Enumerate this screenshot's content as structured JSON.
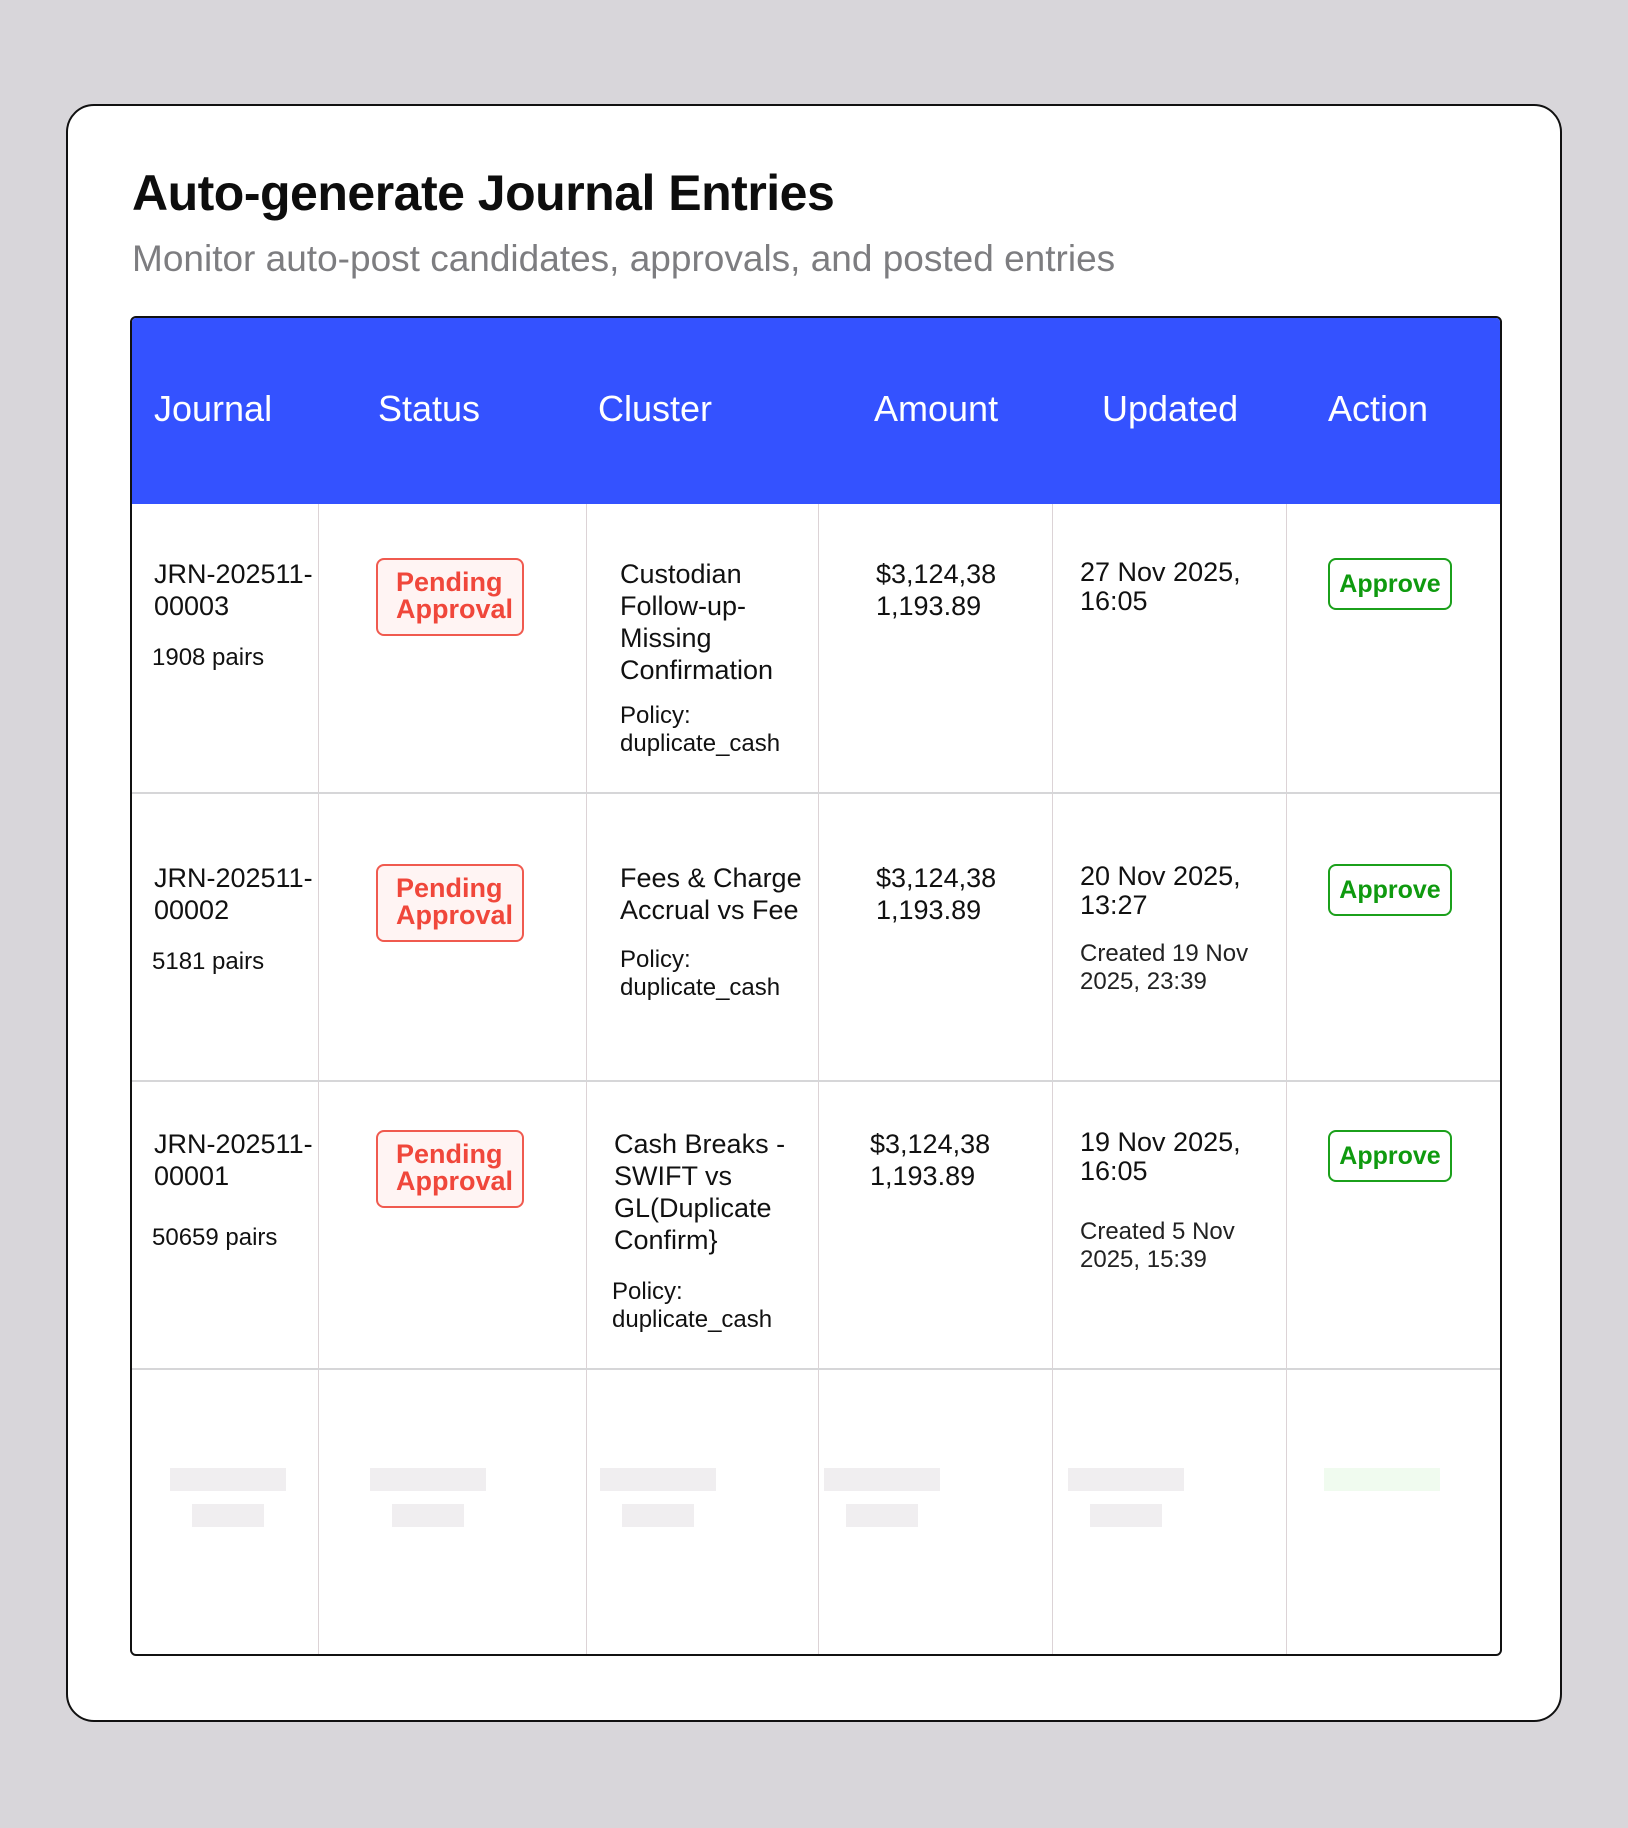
{
  "header": {
    "title": "Auto-generate Journal Entries",
    "subtitle": "Monitor auto-post candidates, approvals, and posted entries"
  },
  "table": {
    "columns": [
      "Journal",
      "Status",
      "Cluster",
      "Amount",
      "Updated",
      "Action"
    ],
    "rows": [
      {
        "journal_id": "JRN-202511-00003",
        "pairs": "1908 pairs",
        "status": "Pending Approval",
        "cluster": "Custodian Follow-up-Missing Confirmation",
        "policy": "Policy: duplicate_cash",
        "amount": "$3,124,38 1,193.89",
        "updated": "27 Nov 2025, 16:05",
        "created": "",
        "action": "Approve"
      },
      {
        "journal_id": "JRN-202511-00002",
        "pairs": "5181 pairs",
        "status": "Pending Approval",
        "cluster": "Fees & Charge Accrual vs Fee",
        "policy": "Policy: duplicate_cash",
        "amount": "$3,124,38 1,193.89",
        "updated": "20 Nov 2025, 13:27",
        "created": "Created 19 Nov 2025, 23:39",
        "action": "Approve"
      },
      {
        "journal_id": "JRN-202511-00001",
        "pairs": "50659 pairs",
        "status": "Pending Approval",
        "cluster": "Cash Breaks - SWIFT vs GL(Duplicate Confirm}",
        "policy": "Policy: duplicate_cash",
        "amount": "$3,124,38 1,193.89",
        "updated": "19 Nov 2025, 16:05",
        "created": "Created 5 Nov 2025, 15:39",
        "action": "Approve"
      }
    ]
  },
  "colors": {
    "header_bg": "#3452ff",
    "pending": "#f0473b",
    "approve": "#0f9a0f"
  }
}
